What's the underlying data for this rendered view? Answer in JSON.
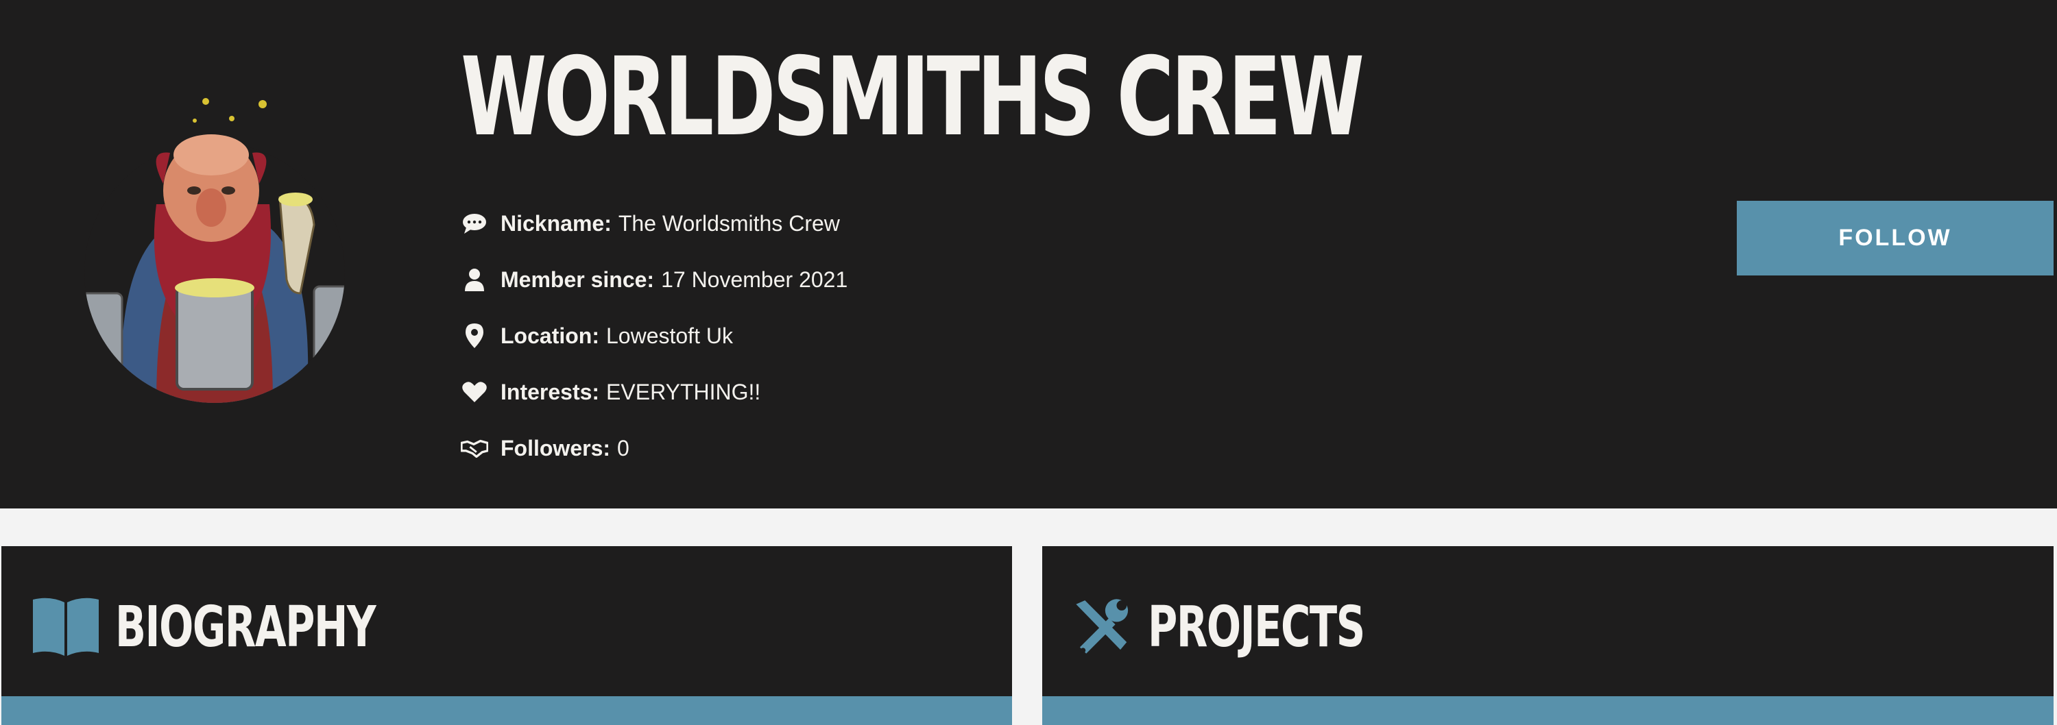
{
  "profile": {
    "name": "WORLDSMITHS CREW",
    "avatar_icon": "dwarf-avatar",
    "info": [
      {
        "icon": "comment-icon",
        "label": "Nickname:",
        "value": "The Worldsmiths Crew"
      },
      {
        "icon": "user-icon",
        "label": "Member since:",
        "value": "17 November 2021"
      },
      {
        "icon": "map-marker-icon",
        "label": "Location:",
        "value": "Lowestoft Uk"
      },
      {
        "icon": "heart-icon",
        "label": "Interests:",
        "value": "EVERYTHING!!"
      },
      {
        "icon": "handshake-icon",
        "label": "Followers:",
        "value": "0"
      }
    ],
    "follow_label": "FOLLOW"
  },
  "panels": {
    "biography": {
      "icon": "book-icon",
      "title": "BIOGRAPHY"
    },
    "projects": {
      "icon": "tools-icon",
      "title": "PROJECTS"
    }
  },
  "colors": {
    "dark_bg": "#1e1d1d",
    "page_bg": "#f3f3f3",
    "accent": "#5891ab",
    "text_light": "#f4f2ee"
  }
}
